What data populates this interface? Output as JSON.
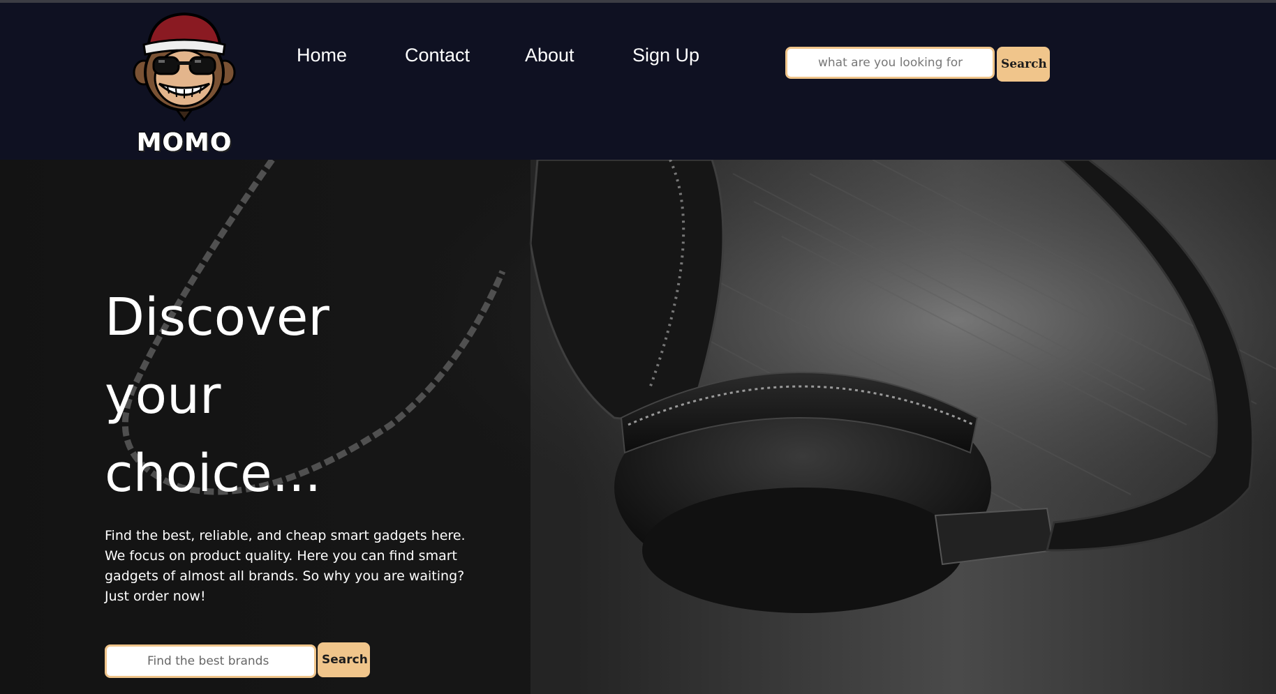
{
  "brand": {
    "logo_text": "MOMO",
    "logo_icon": "monkey-mascot-icon"
  },
  "nav": {
    "items": [
      {
        "label": "Home"
      },
      {
        "label": "Contact"
      },
      {
        "label": "About"
      },
      {
        "label": "Sign Up"
      }
    ]
  },
  "header_search": {
    "placeholder": "what are you looking for",
    "button_label": "Search"
  },
  "hero": {
    "title_lines": [
      "Discover",
      "your",
      "choice..."
    ],
    "description": "Find the best, reliable, and cheap smart gadgets here. We focus on product quality. Here you can find smart gadgets of almost all brands. So why you are waiting? Just order now!",
    "search_placeholder": "Find the best brands",
    "search_button_label": "Search",
    "background_image": "headphones-photo"
  },
  "colors": {
    "navbar_bg": "#0f1122",
    "accent": "#f0c58b",
    "hero_bg": "#1c1c1c",
    "text": "#ffffff"
  }
}
